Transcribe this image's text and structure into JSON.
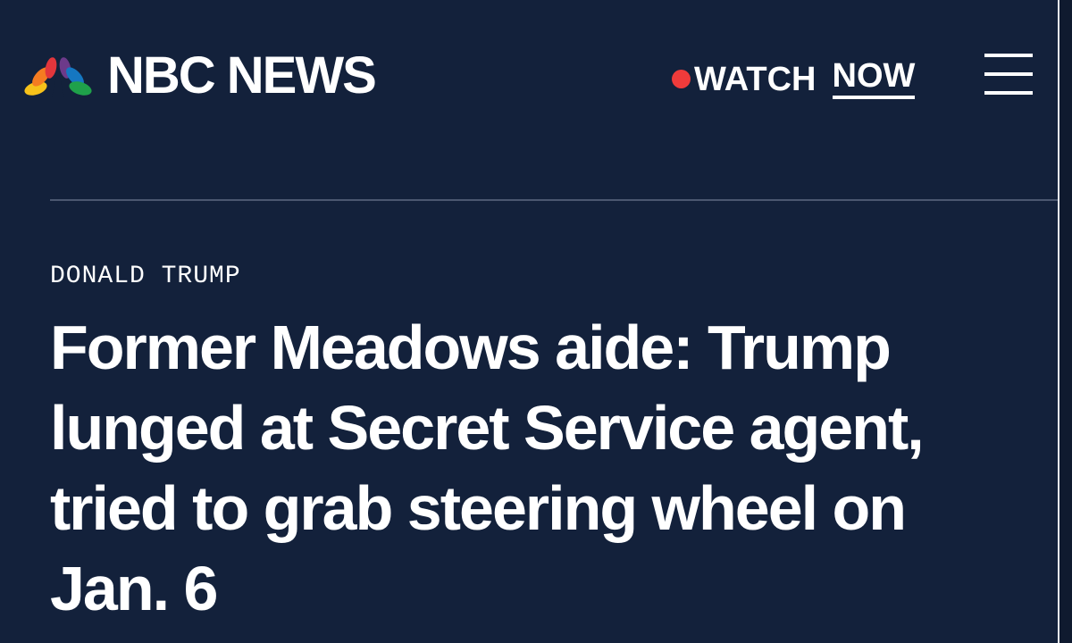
{
  "brand": {
    "name": "NBC NEWS",
    "logo_icon": "nbc-peacock-icon"
  },
  "header": {
    "watch_label": "WATCH",
    "now_label": "NOW",
    "menu_icon": "hamburger-menu-icon"
  },
  "article": {
    "section": "DONALD TRUMP",
    "headline_lines": [
      "Former Meadows aide: Trump",
      "lunged at Secret Service agent,",
      "tried to grab steering wheel on",
      "Jan. 6"
    ]
  },
  "colors": {
    "background": "#13213b",
    "text": "#ffffff",
    "live_dot": "#ef3b3b",
    "divider": "#4b5770"
  }
}
